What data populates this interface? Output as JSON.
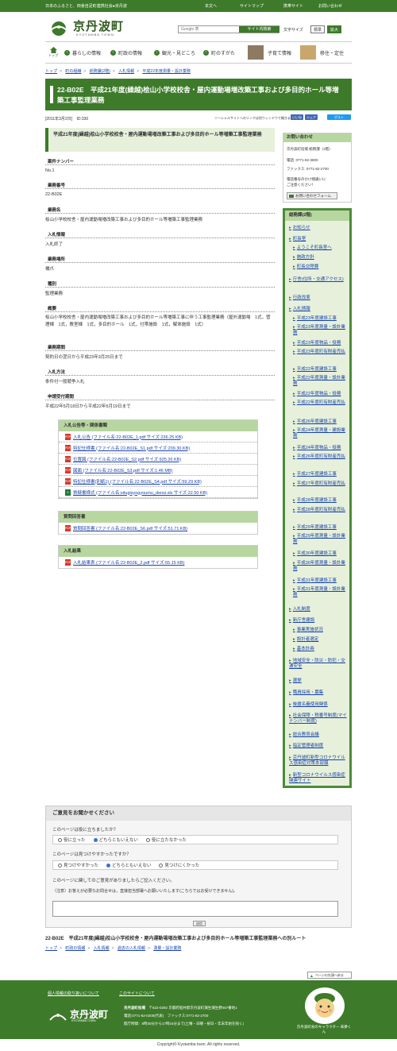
{
  "topbar": {
    "tagline": "日本のふるさと、田舎自足町連携社会●京丹波",
    "links": [
      "本文へ",
      "サイトマップ",
      "携帯サイト",
      "お問い合わせ"
    ]
  },
  "logo": {
    "name": "京丹波町",
    "sub": "KYOTAMBA TOWN"
  },
  "search": {
    "placeholder": "Google 表",
    "button": "サイト内検索"
  },
  "fontsize": {
    "label": "文字サイズ",
    "standard": "標準",
    "large": "拡大"
  },
  "nav": {
    "top": "トップ",
    "items": [
      "暮らしの情報",
      "町政の情報",
      "観光・見どころ",
      "町のすがた",
      "子育て情報",
      "移住・定住"
    ]
  },
  "breadcrumb": [
    "トップ",
    "町の組織",
    "総務課(2階)",
    "入札情報",
    "平成22年度測量・設計業務"
  ],
  "page": {
    "title": "22-B02E　平成21年度(繰越)桧山小学校校舎・屋内運動場増改築工事および多目的ホール等増築工事監理業務",
    "date": "[2011年3月2日]",
    "id": "ID:330",
    "social_note": "ソーシャルサイトへのリンクは別ウィンドウで開きます",
    "like": "いいね",
    "share": "シェア",
    "tweet": "ポスト"
  },
  "main": {
    "heading": "平成21年度(繰越)桧山小学校校舎・屋内運動場増改築工事および多目的ホール等増築工事監理業務",
    "fields": [
      {
        "label": "案件ナンバー",
        "value": "No.1"
      },
      {
        "label": "業務番号",
        "value": "22-B02E"
      },
      {
        "label": "業務名",
        "value": "桧山小学校校舎・屋内運動場増改築工事および多目的ホール等増築工事監理業務"
      },
      {
        "label": "入札情報",
        "value": "入札終了"
      },
      {
        "label": "業務場所",
        "value": "橋爪"
      },
      {
        "label": "種別",
        "value": "監理業務"
      },
      {
        "label": "概要",
        "value": "桧山小学校校舎・屋内運動場増改築工事および多目的ホール等増築工事に伴う工事監理業務（屋外運動場　1式，管理棟　1式，教室棟　1式，多目的ホール　1式，付帯施設　1式，解体施設　1式）"
      },
      {
        "label": "業務期間",
        "value": "契約日の翌日から平成23年3月25日まで"
      },
      {
        "label": "入札方法",
        "value": "条件付一般競争入札"
      },
      {
        "label": "申請受付期間",
        "value": "平成22年5月18日から平成22年5月19日まで"
      }
    ],
    "doc_groups": [
      {
        "title": "入札公告等・関係書類",
        "docs": [
          {
            "type": "PDF",
            "text": "入札公告 (ファイル名:22-B02E_1.pdf サイズ:236.25 KB)"
          },
          {
            "type": "PDF",
            "text": "特記仕様書 (ファイル名:22-B02E_S1.pdf サイズ:209.30 KB)"
          },
          {
            "type": "PDF",
            "text": "位置図 (ファイル名:22-B02E_S2.pdf サイズ:925.26 KB)"
          },
          {
            "type": "PDF",
            "text": "図面 (ファイル名:22-B02E_S3.pdf サイズ:1.46 MB)"
          },
          {
            "type": "PDF",
            "text": "特記仕様書(別紙1) (ファイル名:22-B02E_S4.pdf サイズ:59.29 KB)"
          },
          {
            "type": "XLS",
            "text": "質疑書様式 (ファイル名:situgisyogyoumu_densi.xls サイズ:22.50 KB)"
          }
        ]
      },
      {
        "title": "質問回答書",
        "docs": [
          {
            "type": "PDF",
            "text": "質問回答書 (ファイル名:22-B02E_S6.pdf サイズ:51.71 KB)"
          }
        ]
      },
      {
        "title": "入札結果",
        "docs": [
          {
            "type": "PDF",
            "text": "入札結果表 (ファイル名:22-B02E_2.pdf サイズ:55.15 KB)"
          }
        ]
      }
    ]
  },
  "contact": {
    "head": "お問い合わせ",
    "dept": "京丹波町役場 総務課（2階）",
    "tel": "電話: 0771-82-3800",
    "fax": "ファックス: 0771-82-2700",
    "note1": "電話番号のかけ間違いに",
    "note2": "ご注意ください！",
    "form_button": "お問い合わせフォーム"
  },
  "sidebar": {
    "head": "総務課(2階)",
    "items": [
      "お知らせ",
      "町長室",
      "ようこそ町長室へ",
      "施政方針",
      "町長交際費",
      "庁舎(住所・交通アクセス)",
      "行政改革",
      "入札情報",
      "平成23年度建設工事",
      "平成23年度測量・設計業務",
      "平成23年度物品・役務",
      "平成23年度町有財産売払",
      "平成22年度建設工事",
      "平成22年度測量・設計業務",
      "平成22年度物品・役務",
      "平成22年度町有財産売払",
      "平成26年度建設工事",
      "平成24年度測量・建設業務",
      "平成24年度物品・役務",
      "平成26年度町有財産売払",
      "平成27年度建設工事",
      "平成27年度町有財産売払",
      "平成28年度建設工事",
      "平成28年度町有財産売払",
      "平成29年度建設工事",
      "平成29年度測量・設計業務",
      "平成30年度建設工事",
      "平成30年度測量・設計業務",
      "平成31年度建設工事",
      "平成31年度測量・設計業務",
      "入札制度",
      "新庁舎建設",
      "事業実施状況",
      "設計者選定",
      "基本計画",
      "地域安全・防災・防犯・交通安全",
      "選挙",
      "職員採用・募集",
      "後援名義使用関係",
      "社会保障・税番号制度(マイナンバー制度)",
      "総合教育会議",
      "指定管理者制度",
      "京丹波町新型コロナウイルス感染症対策本部報",
      "新型コロナウイルス感染症関連サイト"
    ]
  },
  "feedback": {
    "head": "ご意見をお聞かせください",
    "q1": "このページは役に立ちましたか？",
    "q1_options": [
      "役に立った",
      "どちらともいえない",
      "役に立たなかった"
    ],
    "q2": "このページは見つけやすかったですか？",
    "q2_options": [
      "見つけやすかった",
      "どちらともいえない",
      "見つけにくかった"
    ],
    "q3": "このページに関してのご意見がありましたらご記入ください。",
    "note": "（注意）お答えが必要なお問合せは，直接担当部署へお願いいたします(こちらではお受けできません)。",
    "submit": "送信"
  },
  "route": "22-B02E　平成21年度(繰越)桧山小学校校舎・屋内運動場増改築工事および多目的ホール等増築工事監理業務への別ルート",
  "route_crumb": [
    "トップ",
    "町政の情報",
    "入札情報",
    "過去の入札情報",
    "測量・設計業務"
  ],
  "totop": "ページの先頭へ戻る",
  "footer": {
    "links": [
      "個人情報の取り扱いについて",
      "このサイトについて"
    ],
    "town": "京丹波町役場",
    "address": "〒622-0292 京都府船井郡京丹波町蒲生蒲生野487番地1",
    "phone": "電話:0771-82-0200(代表)　ファックス:0771-82-2700",
    "hours": "開庁時間：8時30分から17時15分まで(土曜・日曜・祝日・年末年始を除く)",
    "logo_name": "京丹波町",
    "logo_sub": "KYOTAMBA TOWN",
    "mascot_caption": "京丹波町食のキャラクター 味夢くん"
  },
  "copyright": "Copyright© Kyotamba town. All rights reserved."
}
